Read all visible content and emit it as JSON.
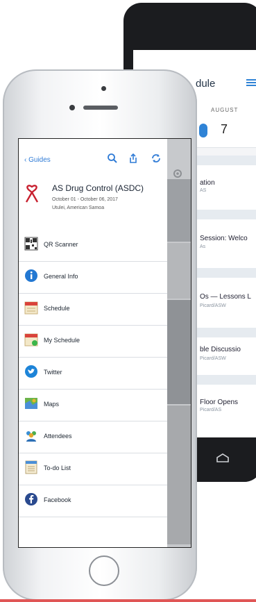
{
  "android": {
    "header_title": "dule",
    "menu_icon": "menu-icon",
    "month": "AUGUST",
    "day": "7",
    "sessions": [
      {
        "title": "ation",
        "sub": "AS"
      },
      {
        "title": "Session: Welco",
        "sub": "As"
      },
      {
        "title": "Os — Lessons L",
        "sub": "Picard/ASW"
      },
      {
        "title": "ble Discussio",
        "sub": "Picard/ASW"
      },
      {
        "title": "Floor Opens",
        "sub": "Picard/AS"
      }
    ]
  },
  "iphone": {
    "nav": {
      "back_label": "Guides",
      "search_icon": "search-icon",
      "share_icon": "share-icon",
      "refresh_icon": "refresh-icon"
    },
    "event": {
      "title": "AS Drug Control (ASDC)",
      "dates": "October 01 - October 06, 2017",
      "location": "Utulei, American Samoa"
    },
    "menu": [
      {
        "label": "QR Scanner",
        "icon": "qr-code-icon"
      },
      {
        "label": "General Info",
        "icon": "info-icon"
      },
      {
        "label": "Schedule",
        "icon": "calendar-icon"
      },
      {
        "label": "My Schedule",
        "icon": "my-calendar-icon"
      },
      {
        "label": "Twitter",
        "icon": "twitter-icon"
      },
      {
        "label": "Maps",
        "icon": "map-icon"
      },
      {
        "label": "Attendees",
        "icon": "attendees-icon"
      },
      {
        "label": "To-do List",
        "icon": "todo-list-icon"
      },
      {
        "label": "Facebook",
        "icon": "facebook-icon"
      }
    ]
  },
  "colors": {
    "accent": "#2f7bd6",
    "logo_red": "#c8202f",
    "facebook": "#2a4a8f",
    "twitter": "#1d84d8"
  }
}
